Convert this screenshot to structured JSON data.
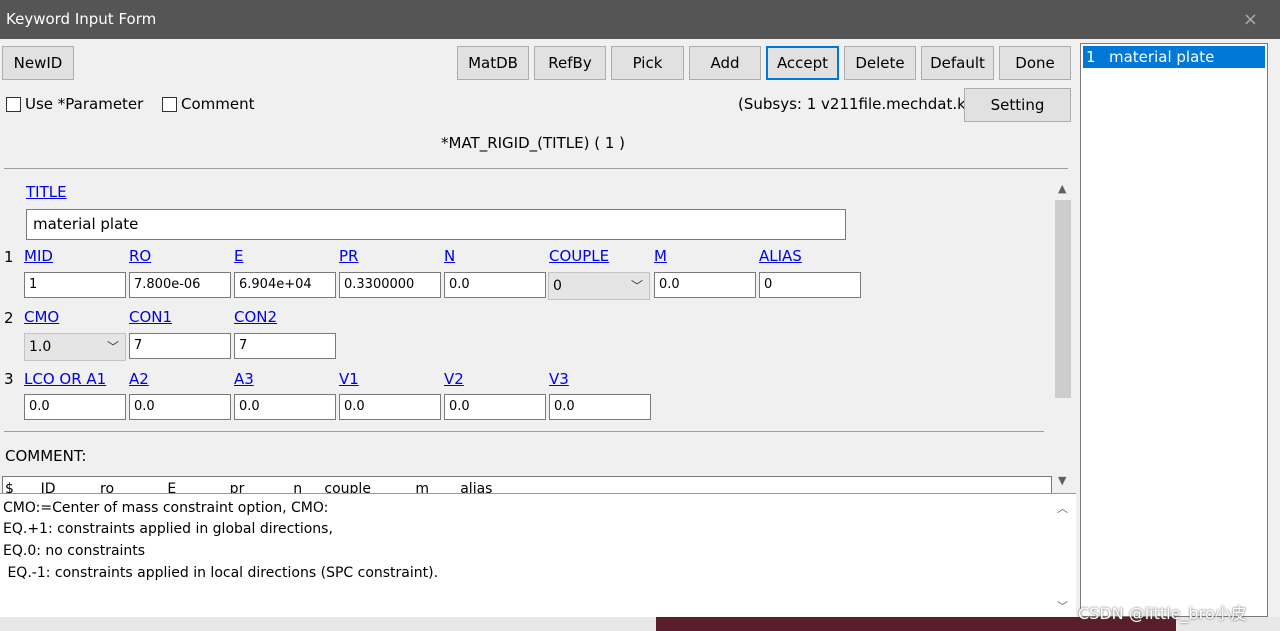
{
  "window": {
    "title": "Keyword Input Form",
    "close_icon": "×"
  },
  "toolbar": {
    "newid": "NewID",
    "matdb": "MatDB",
    "refby": "RefBy",
    "pick": "Pick",
    "add": "Add",
    "accept": "Accept",
    "delete": "Delete",
    "default": "Default",
    "done": "Done",
    "setting": "Setting"
  },
  "options": {
    "use_parameter": "Use *Parameter",
    "comment": "Comment",
    "subsys": "(Subsys: 1 v211file.mechdat.k)"
  },
  "keyword": {
    "header": "*MAT_RIGID_(TITLE)    ( 1 )"
  },
  "title_field": {
    "label": "TITLE",
    "value": "material plate"
  },
  "row1": {
    "num": "1",
    "labels": [
      "MID",
      "RO",
      "E",
      "PR",
      "N",
      "COUPLE",
      "M",
      "ALIAS"
    ],
    "mid": "1",
    "ro": "7.800e-06",
    "e": "6.904e+04",
    "pr": "0.3300000",
    "n": "0.0",
    "couple": "0",
    "m": "0.0",
    "alias": "0"
  },
  "row2": {
    "num": "2",
    "labels": [
      "CMO",
      "CON1",
      "CON2"
    ],
    "cmo": "1.0",
    "con1": "7",
    "con2": "7"
  },
  "row3": {
    "num": "3",
    "labels": [
      "LCO OR A1",
      "A2",
      "A3",
      "V1",
      "V2",
      "V3"
    ],
    "values": [
      "0.0",
      "0.0",
      "0.0",
      "0.0",
      "0.0",
      "0.0"
    ]
  },
  "comment": {
    "label": "COMMENT:",
    "text": "$      ID          ro            E            pr           n     couple          m       alias"
  },
  "help": {
    "lines": [
      "CMO:=Center of mass constraint option, CMO:",
      "EQ.+1: constraints applied in global directions,",
      "EQ.0: no constraints",
      " EQ.-1: constraints applied in local directions (SPC constraint)."
    ]
  },
  "list": {
    "item_num": "1",
    "item_label": "material plate"
  },
  "watermark": "CSDN @little_bro小皮"
}
